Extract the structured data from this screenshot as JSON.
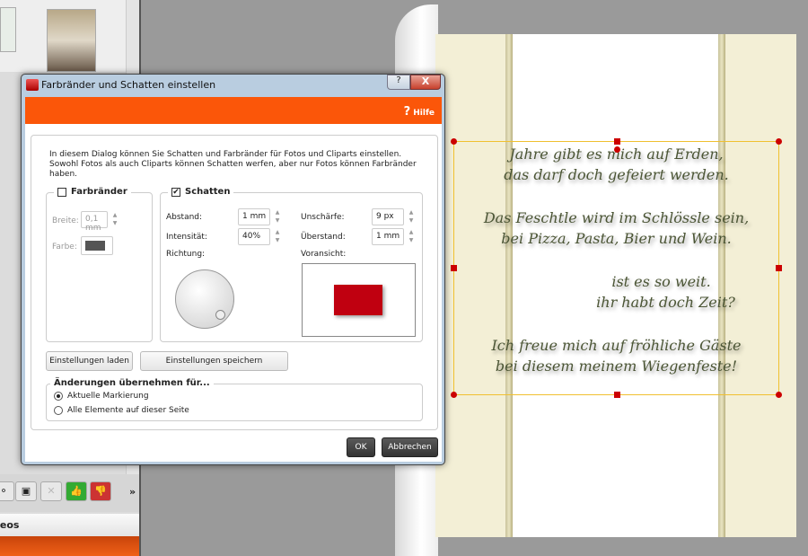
{
  "background_app": {
    "panel_label": "deos",
    "toolbar_more": "»",
    "toolbar_icons": [
      "add-circle-icon",
      "video-icon",
      "disabled-tool-icon",
      "thumbs-up-icon",
      "thumbs-down-icon"
    ]
  },
  "card": {
    "verse": [
      "Jahre gibt es mich auf Erden,",
      "das darf doch gefeiert werden.",
      "Das Feschtle wird im Schlössle sein,",
      "bei Pizza, Pasta, Bier und Wein.",
      "ist es so weit.",
      "ihr habt doch Zeit?",
      "Ich freue mich auf fröhliche Gäste",
      "bei diesem meinem Wiegenfeste!"
    ],
    "selection_color": "#f0c030",
    "handle_color": "#cc0000"
  },
  "dialog": {
    "title": "Farbränder und Schatten einstellen",
    "help_button": "?",
    "close_button": "X",
    "help_link": "Hilfe",
    "help_glyph": "?",
    "accent": "#fb5609",
    "description": "In diesem Dialog können Sie Schatten und Farbränder für Fotos und Cliparts einstellen. Sowohl Fotos als auch Cliparts können Schatten werfen, aber nur Fotos können Farbränder haben.",
    "farbraender": {
      "label": "Farbränder",
      "checked": false,
      "breite_label": "Breite:",
      "breite_value": "0,1 mm",
      "farbe_label": "Farbe:",
      "farbe_color": "#555555"
    },
    "schatten": {
      "label": "Schatten",
      "checked": true,
      "abstand_label": "Abstand:",
      "abstand_value": "1 mm",
      "intensitaet_label": "Intensität:",
      "intensitaet_value": "40%",
      "richtung_label": "Richtung:",
      "unschaerfe_label": "Unschärfe:",
      "unschaerfe_value": "9 px",
      "ueberstand_label": "Überstand:",
      "ueberstand_value": "1 mm",
      "voransicht_label": "Voransicht:",
      "preview_color": "#c00010"
    },
    "load_button": "Einstellungen laden",
    "save_button": "Einstellungen speichern",
    "apply_group": {
      "label": "Änderungen übernehmen für...",
      "options": [
        {
          "label": "Aktuelle Markierung",
          "selected": true
        },
        {
          "label": "Alle Elemente auf dieser Seite",
          "selected": false
        }
      ]
    },
    "ok_button": "OK",
    "cancel_button": "Abbrechen"
  }
}
